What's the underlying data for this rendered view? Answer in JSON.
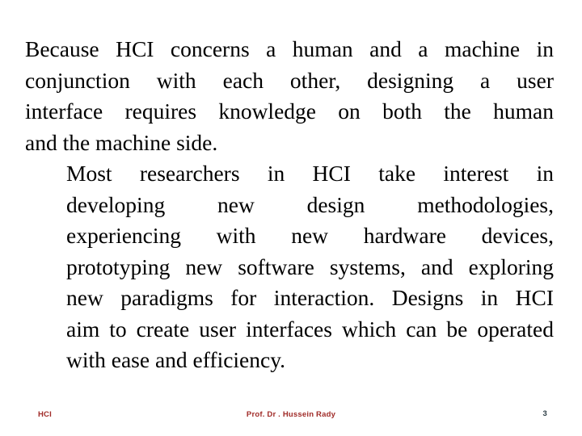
{
  "slide": {
    "page_number": "3",
    "background_color": "#ffffff",
    "text_color": "#000000",
    "footer_accent_color": "#a02b28",
    "page_number_color": "#2b3c44"
  },
  "content": {
    "paragraphs": [
      {
        "indented": false,
        "text": "Because HCI concerns a human and a machine in conjunction with each other, designing a user interface requires knowledge on both the human and the machine side.",
        "lines": [
          "Because HCI concerns a human and a machine in",
          "conjunction with each other, designing a user",
          "interface requires knowledge on both the human",
          "and the machine side."
        ]
      },
      {
        "indented": true,
        "text": "Most researchers in HCI take interest in developing new design methodologies, experiencing with new hardware devices, prototyping new software systems, and exploring new paradigms for interaction. Designs in HCI aim to create user interfaces which can be operated with ease and efficiency.",
        "lines": [
          "Most researchers in HCI take interest in",
          "developing new design methodologies,",
          "experiencing with new hardware devices,",
          "prototyping new software systems, and exploring",
          "new paradigms for interaction. Designs in HCI",
          "aim to create user interfaces which can be operated",
          "with ease and efficiency."
        ]
      }
    ]
  },
  "footer": {
    "left_label": "HCI",
    "center_label": "Prof.  Dr . Hussein Rady",
    "right_label": "3"
  }
}
